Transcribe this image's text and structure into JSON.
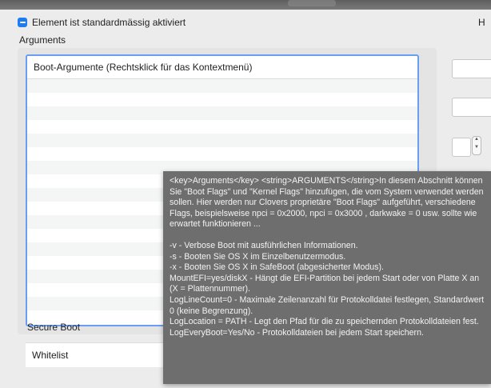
{
  "window": {
    "title_blurred": true
  },
  "enable": {
    "label": "Element ist standardmässig aktiviert",
    "checked": true
  },
  "right_label": "H",
  "arguments": {
    "section_label": "Arguments",
    "header": "Boot-Argumente (Rechtsklick für das Kontextmenü)",
    "row_count": 18
  },
  "tooltip": {
    "paragraphs": [
      "<key>Arguments</key> <string>ARGUMENTS</string>In diesem Abschnitt können Sie \"Boot Flags\" und \"Kernel Flags\" hinzufügen, die vom System verwendet werden sollen. Hier werden nur Clovers proprietäre \"Boot Flags\" aufgeführt, verschiedene Flags, beispielsweise npci = 0x2000, npci = 0x3000 , darkwake = 0 usw. sollte wie erwartet funktionieren ...",
      "-v - Verbose Boot mit ausführlichen Informationen.\n-s - Booten Sie OS X im Einzelbenutzermodus.\n-x - Booten Sie OS X in SafeBoot (abgesicherter Modus).\nMountEFI=yes/diskX - Hängt die EFI-Partition bei jedem Start oder von Platte X an (X = Plattennummer).\nLogLineCount=0 - Maximale Zeilenanzahl für Protokolldatei festlegen, Standardwert 0 (keine Begrenzung).\nLogLocation = PATH - Legt den Pfad für die zu speichernden Protokolldateien fest.\nLogEveryBoot=Yes/No - Protokolldateien bei jedem Start speichern."
    ]
  },
  "secure_boot": {
    "section_label": "Secure Boot",
    "whitelist_label": "Whitelist"
  },
  "colors": {
    "accent": "#1d7cf2",
    "focus_ring": "#6a9ef5",
    "tooltip_bg": "#6e6e6e"
  }
}
